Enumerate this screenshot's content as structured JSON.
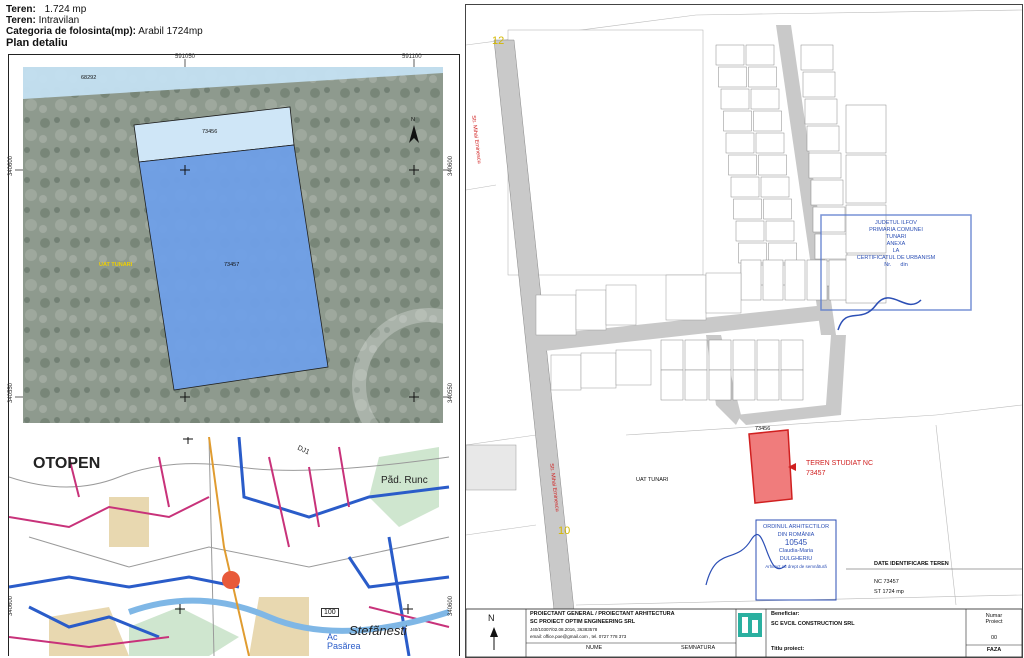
{
  "header": {
    "teren_label": "Teren:",
    "teren_area": "1.724 mp",
    "teren_type_label": "Teren:",
    "teren_type": "Intravilan",
    "category_label": "Categoria de folosinta(mp):",
    "category_value": "Arabil 1724mp",
    "plan_title": "Plan detaliu"
  },
  "ortho_map": {
    "coord_x1": "591050",
    "coord_x2": "591100",
    "coord_y1": "340600",
    "coord_y2": "340550",
    "parcel_top": "68292",
    "parcel_strip": "73456",
    "parcel_main": "73457",
    "uat_label": "UAT TUNARI",
    "north": "N"
  },
  "location_map": {
    "place_otopeni": "OTOPEN",
    "place_pad_runc": "Pãd. Runc",
    "road_label": "100",
    "place_ac_pasarea": "Ac\nPasãrea",
    "place_stefanesti": "Stefãnesti",
    "coord_left": "340600",
    "road_dn": "DJ1"
  },
  "plan": {
    "street_top": "Str. Mihai Eminescu",
    "street_bottom": "Str. Mihai Eminescu",
    "num_12": "12",
    "num_10": "10",
    "uat": "UAT TUNARI",
    "parcel_73456": "73456",
    "studied_line1": "TEREN STUDIAT NC",
    "studied_line2": "73457",
    "stamp_top_1": "JUDETUL ILFOV",
    "stamp_top_2": "PRIMARIA COMUNEI",
    "stamp_top_3": "TUNARI",
    "stamp_top_4": "ANEXA",
    "stamp_top_5": "LA",
    "stamp_top_6": "CERTIFICATUL DE URBANISM",
    "stamp_top_7": "Nr.",
    "stamp_top_8": "din",
    "arch_1": "ORDINUL ARHITECTILOR",
    "arch_2": "DIN ROMÂNIA",
    "arch_3": "10545",
    "arch_4": "Claudia-Maria",
    "arch_5": "DULGHERIU",
    "arch_6": "Arhitect cu drept de semnãturã",
    "date_id_title": "DATE IDENTIFICARE TEREN",
    "date_id_nc": "NC 73457",
    "date_id_st": "ST 1724 mp",
    "north": "N"
  },
  "titleblock": {
    "designer_title": "PROIECTANT GENERAL / PROIECTANT ARHITECTURA",
    "company": "SC PROIECT OPTIM ENGINEERING SRL",
    "reg": "J40/10307/02.08.2016, 36383578",
    "email": "email: office.poe@gmail.com , tel. 0727 778 373",
    "col_nume": "NUME",
    "col_semnatura": "SEMNATURA",
    "beneficiar_label": "Beneficiar:",
    "beneficiar": "SC EVCIL CONSTRUCTION SRL",
    "titlu_label": "Titlu proiect:",
    "numar_label": "Numar\nProiect",
    "numar_value": "00",
    "faza_label": "FAZA"
  }
}
